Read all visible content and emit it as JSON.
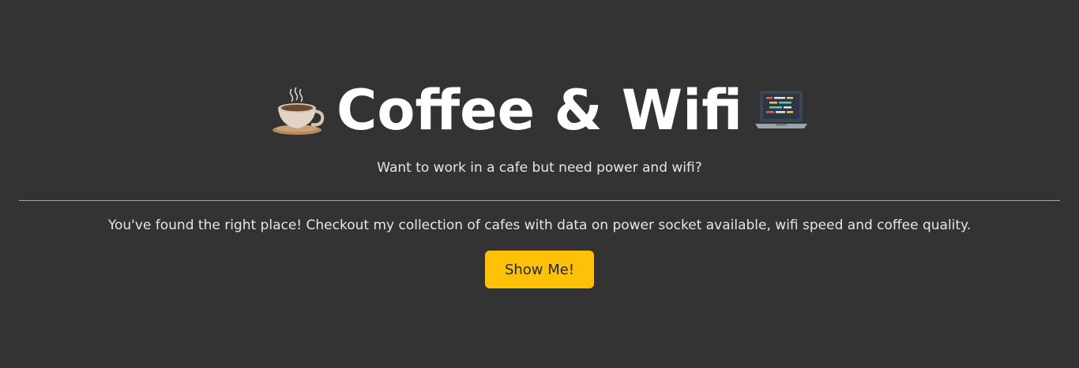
{
  "hero": {
    "title": "Coffee & Wifi",
    "left_icon": "coffee-cup-icon",
    "right_icon": "laptop-icon",
    "subtitle": "Want to work in a cafe but need power and wifi?",
    "lead": "You've found the right place! Checkout my collection of cafes with data on power socket available, wifi speed and coffee quality.",
    "button_label": "Show Me!"
  },
  "colors": {
    "background": "#333333",
    "text": "#ffffff",
    "button": "#ffc107",
    "divider": "#a6a6a6"
  }
}
